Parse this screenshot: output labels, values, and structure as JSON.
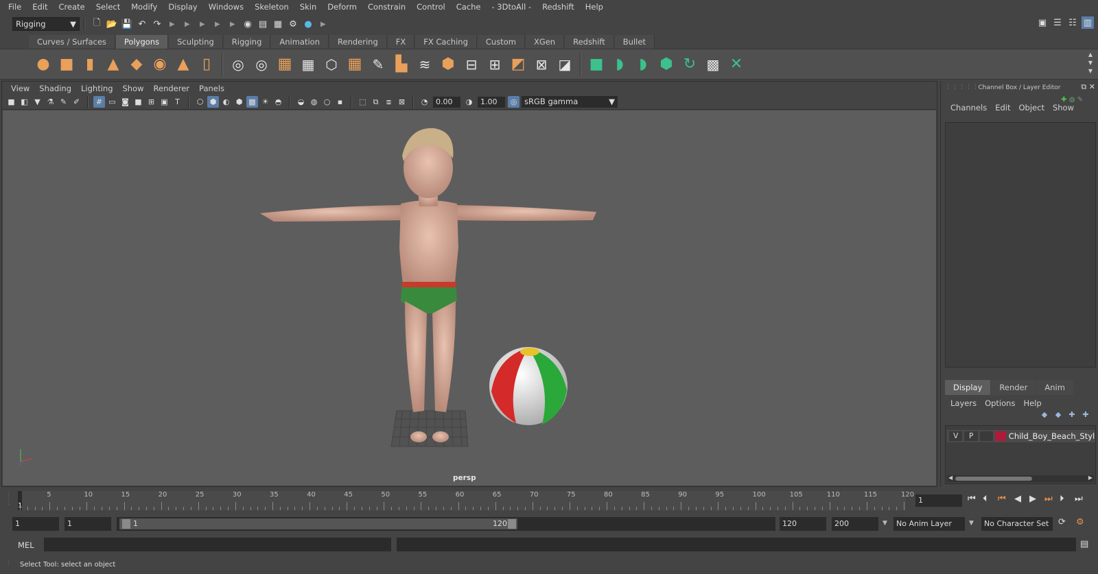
{
  "menubar": [
    "File",
    "Edit",
    "Create",
    "Select",
    "Modify",
    "Display",
    "Windows",
    "Skeleton",
    "Skin",
    "Deform",
    "Constrain",
    "Control",
    "Cache",
    "- 3DtoAll -",
    "Redshift",
    "Help"
  ],
  "statusline": {
    "menuset": "Rigging"
  },
  "shelf": {
    "tabs": [
      "Curves / Surfaces",
      "Polygons",
      "Sculpting",
      "Rigging",
      "Animation",
      "Rendering",
      "FX",
      "FX Caching",
      "Custom",
      "XGen",
      "Redshift",
      "Bullet"
    ],
    "active_tab": "Polygons"
  },
  "viewport": {
    "menu": [
      "View",
      "Shading",
      "Lighting",
      "Show",
      "Renderer",
      "Panels"
    ],
    "exposure": "0.00",
    "gamma": "1.00",
    "color_space": "sRGB gamma",
    "camera_label": "persp"
  },
  "channel_box": {
    "title": "Channel Box / Layer Editor",
    "menu": [
      "Channels",
      "Edit",
      "Object",
      "Show"
    ]
  },
  "layer_editor": {
    "tabs": [
      "Display",
      "Render",
      "Anim"
    ],
    "active_tab": "Display",
    "menu": [
      "Layers",
      "Options",
      "Help"
    ],
    "layers": [
      {
        "visible": "V",
        "playback": "P",
        "color": "#b01a3a",
        "name": "Child_Boy_Beach_Style_T"
      }
    ]
  },
  "time_slider": {
    "ticks": [
      "5",
      "10",
      "15",
      "20",
      "25",
      "30",
      "35",
      "40",
      "45",
      "50",
      "55",
      "60",
      "65",
      "70",
      "75",
      "80",
      "85",
      "90",
      "95",
      "100",
      "105",
      "110",
      "115",
      "120"
    ],
    "current_frame_label": "1",
    "current_frame": "1"
  },
  "range_slider": {
    "start": "1",
    "playback_start": "1",
    "range_start_label": "1",
    "range_end_label": "120",
    "playback_end": "120",
    "end": "200",
    "anim_layer": "No Anim Layer",
    "character_set": "No Character Set"
  },
  "command_line": {
    "language": "MEL"
  },
  "help_line": {
    "text": "Select Tool: select an object"
  },
  "colors": {
    "accent": "#5b7ea8",
    "viewport_bg": "#5d5d5d",
    "panel_bg": "#444444",
    "layer": "#b01a3a"
  }
}
